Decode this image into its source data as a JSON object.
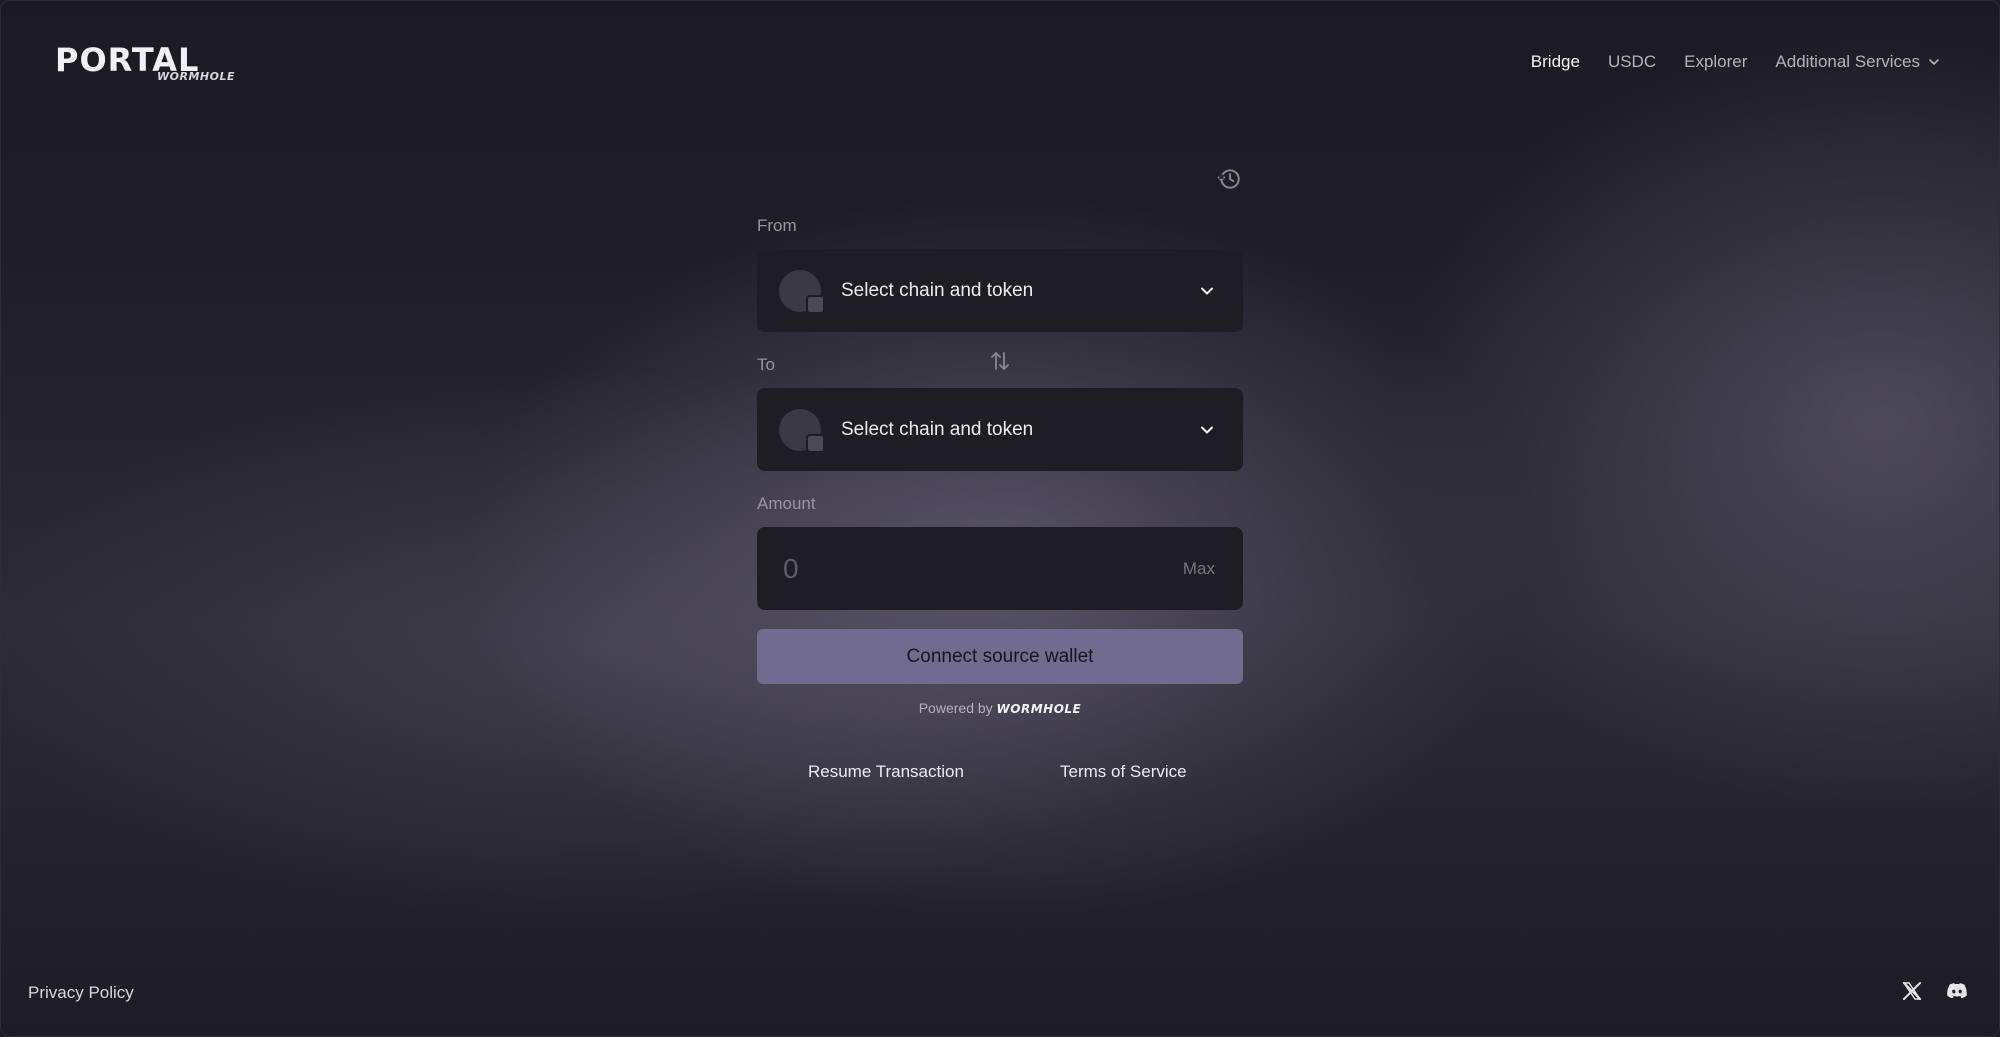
{
  "header": {
    "logo_text": "PORTAL",
    "logo_sub": "WORMHOLE",
    "nav": [
      {
        "label": "Bridge",
        "active": true
      },
      {
        "label": "USDC",
        "active": false
      },
      {
        "label": "Explorer",
        "active": false
      },
      {
        "label": "Additional Services",
        "active": false,
        "dropdown": true
      }
    ]
  },
  "form": {
    "history_icon": "history-icon",
    "from_label": "From",
    "from_select": "Select chain and token",
    "to_label": "To",
    "to_select": "Select chain and token",
    "swap_icon": "swap-arrows-icon",
    "amount_label": "Amount",
    "amount_placeholder": "0",
    "max_label": "Max",
    "connect_button": "Connect source wallet",
    "powered_by": "Powered by",
    "powered_brand": "WORMHOLE"
  },
  "links": {
    "resume": "Resume Transaction",
    "terms": "Terms of Service"
  },
  "footer": {
    "privacy": "Privacy Policy",
    "social_icons": [
      "x-icon",
      "discord-icon"
    ]
  },
  "colors": {
    "background": "#1d1c24",
    "field_background": "#1e1d24",
    "accent_button": "#716b8f",
    "text_primary": "#ecebf0",
    "text_muted": "#98949f"
  }
}
